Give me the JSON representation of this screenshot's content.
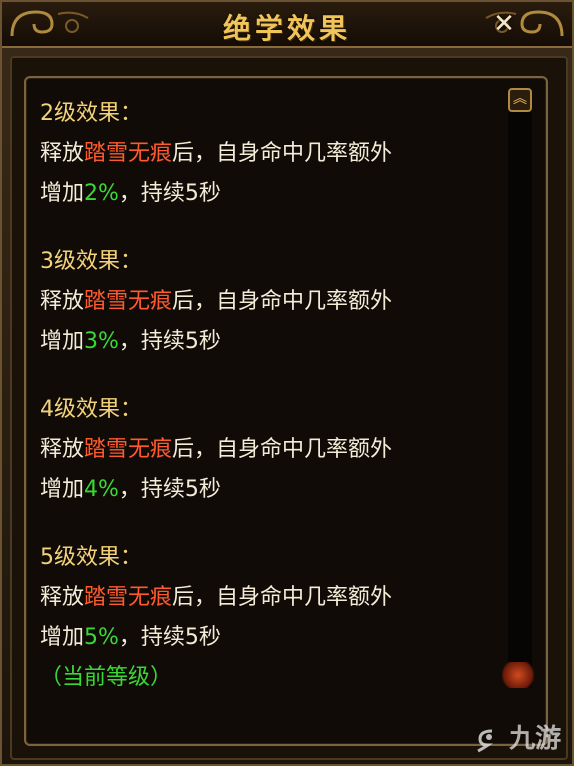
{
  "window": {
    "title": "绝学效果",
    "close_glyph": "✕"
  },
  "effects": [
    {
      "level_title": "2级效果：",
      "line1_prefix": "释放",
      "skill": "踏雪无痕",
      "line1_suffix": "后，自身命中几率额外",
      "line2_prefix": "增加",
      "value": "2%",
      "line2_suffix": "，持续5秒"
    },
    {
      "level_title": "3级效果：",
      "line1_prefix": "释放",
      "skill": "踏雪无痕",
      "line1_suffix": "后，自身命中几率额外",
      "line2_prefix": "增加",
      "value": "3%",
      "line2_suffix": "，持续5秒"
    },
    {
      "level_title": "4级效果：",
      "line1_prefix": "释放",
      "skill": "踏雪无痕",
      "line1_suffix": "后，自身命中几率额外",
      "line2_prefix": "增加",
      "value": "4%",
      "line2_suffix": "，持续5秒"
    },
    {
      "level_title": "5级效果：",
      "line1_prefix": "释放",
      "skill": "踏雪无痕",
      "line1_suffix": "后，自身命中几率额外",
      "line2_prefix": "增加",
      "value": "5%",
      "line2_suffix": "，持续5秒"
    }
  ],
  "current_level_label": "（当前等级）",
  "scrollbar": {
    "up_glyph": "︽"
  },
  "watermark": {
    "text": "九游"
  },
  "colors": {
    "title_gold": "#f0c458",
    "level_title": "#f3d27a",
    "skill_red": "#ff5a2e",
    "value_green": "#39d835",
    "body_text": "#f2ecd8"
  }
}
